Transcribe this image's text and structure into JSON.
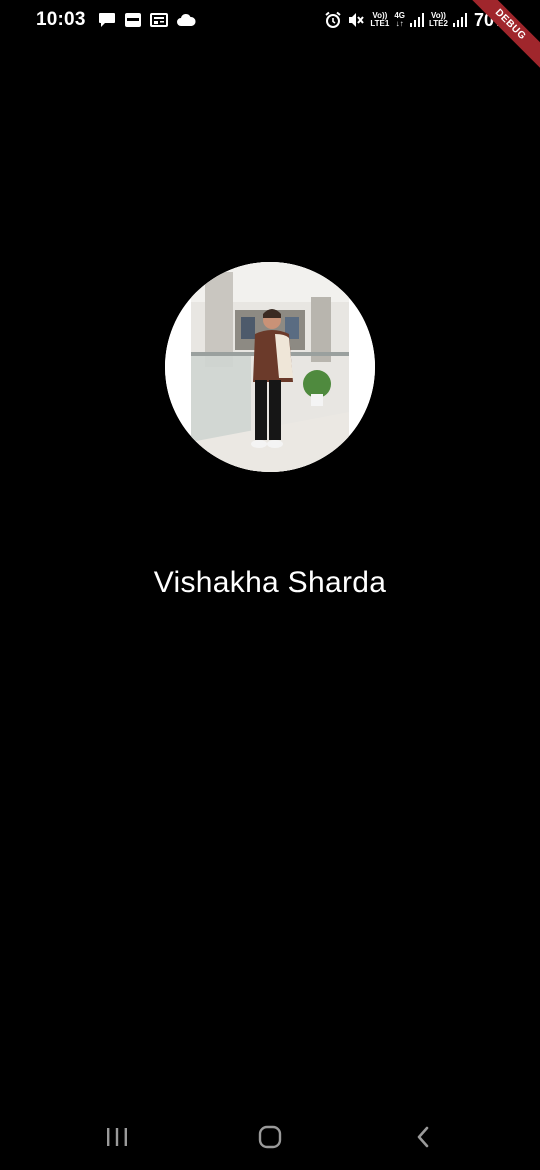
{
  "status_bar": {
    "time": "10:03",
    "left_icons": [
      "chat-bubble-icon",
      "photo-app-icon",
      "news-icon",
      "cloud-icon"
    ],
    "sim1_label_top": "Vo))",
    "sim1_label_bottom": "LTE1",
    "network_label_top": "4G",
    "network_label_bottom": "↓↑",
    "sim2_label_top": "Vo))",
    "sim2_label_bottom": "LTE2",
    "battery": "70%"
  },
  "debug_banner": "DEBUG",
  "profile": {
    "name": "Vishakha Sharda"
  },
  "navigation": {
    "recents": "recent-apps-icon",
    "home": "home-icon",
    "back": "back-icon"
  }
}
